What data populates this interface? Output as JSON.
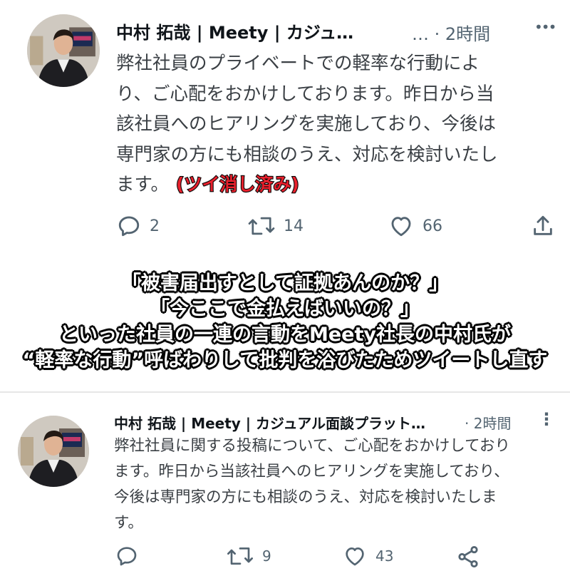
{
  "tweet1": {
    "name": "中村 拓哉 | Meety | カジュ…",
    "meta": "… · 2時間",
    "more": "•••",
    "lines": [
      "弊社社員のプライベートでの軽率な行動によ",
      "り、ご心配をおかけしております。昨日から当",
      "該社員へのヒアリングを実施しており、今後は",
      "専門家の方にも相談のうえ、対応を検討いたし",
      "ます。"
    ],
    "deleted_note": "(ツイ消し済み)",
    "replies": "2",
    "retweets": "14",
    "likes": "66"
  },
  "caption": {
    "lines": [
      "「被害届出すとして証拠あんのか？」",
      "「今ここで金払えばいいの？」",
      "といった社員の一連の言動をMeety社長の中村氏が",
      "“軽率な行動”呼ばわりして批判を浴びたためツイートし直す"
    ]
  },
  "tweet2": {
    "name": "中村 拓哉 | Meety | カジュアル面談プラット…",
    "meta": "· 2時間",
    "more": "⋮",
    "lines": [
      "弊社社員に関する投稿について、ご心配をおかけしており",
      "ます。昨日から当該社員へのヒアリングを実施しており、",
      "今後は専門家の方にも相談のうえ、対応を検討いたしま",
      "す。"
    ],
    "replies": "",
    "retweets": "9",
    "likes": "43"
  },
  "icons": [
    "reply-icon",
    "retweet-icon",
    "like-icon",
    "share-icon",
    "share-android-icon",
    "more-icon"
  ]
}
